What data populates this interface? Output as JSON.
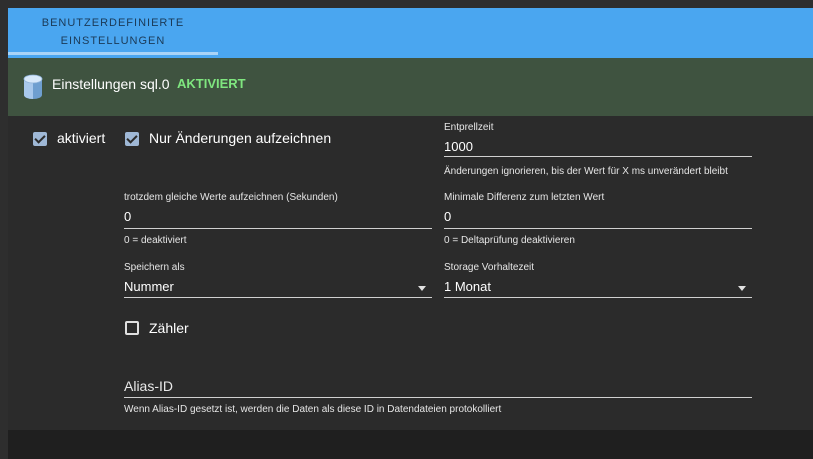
{
  "tabs": [
    {
      "label_line1": "BENUTZERDEFINIERTE",
      "label_line2": "EINSTELLUNGEN"
    }
  ],
  "header": {
    "icon": "database-icon",
    "title": "Einstellungen sql.0",
    "status": "AKTIVIERT"
  },
  "form": {
    "enabled": {
      "label": "aktiviert",
      "checked": true
    },
    "changes_only": {
      "label": "Nur Änderungen aufzeichnen",
      "checked": true
    },
    "debounce": {
      "label": "Entprellzeit",
      "value": "1000",
      "helper": "Änderungen ignorieren, bis der Wert für X ms unverändert bleibt"
    },
    "same_values": {
      "label": "trotzdem gleiche Werte aufzeichnen (Sekunden)",
      "value": "0",
      "helper": "0 = deaktiviert"
    },
    "min_diff": {
      "label": "Minimale Differenz zum letzten Wert",
      "value": "0",
      "helper": "0 = Deltaprüfung deaktivieren"
    },
    "store_as": {
      "label": "Speichern als",
      "value": "Nummer"
    },
    "retention": {
      "label": "Storage Vorhaltezeit",
      "value": "1 Monat"
    },
    "counter": {
      "label": "Zähler",
      "checked": false
    },
    "alias": {
      "placeholder": "Alias-ID",
      "helper": "Wenn Alias-ID gesetzt ist, werden die Daten als diese ID in Datendateien protokolliert"
    }
  },
  "colors": {
    "tab_bar": "#4aa6f0",
    "header_bg": "#3f5340",
    "status_green": "#7fe67f",
    "panel_bg": "#2b2b2b",
    "checkbox_checked": "#9fb8d6"
  }
}
